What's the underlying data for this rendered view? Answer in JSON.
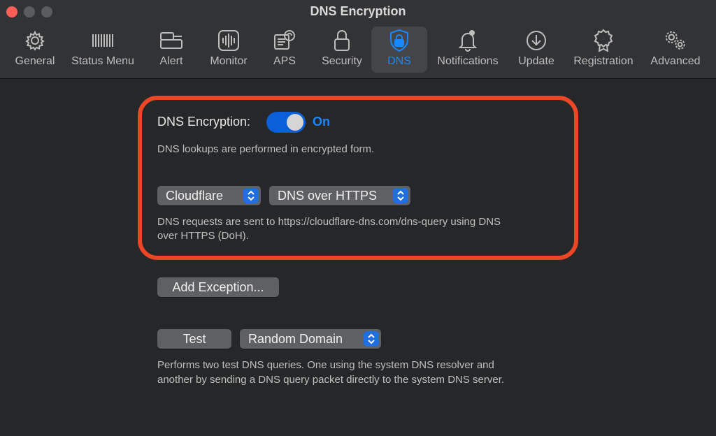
{
  "window": {
    "title": "DNS Encryption"
  },
  "toolbar": {
    "items": [
      {
        "label": "General",
        "icon": "gear-icon"
      },
      {
        "label": "Status Menu",
        "icon": "status-menu-icon"
      },
      {
        "label": "Alert",
        "icon": "alert-window-icon"
      },
      {
        "label": "Monitor",
        "icon": "monitor-waveform-icon"
      },
      {
        "label": "APS",
        "icon": "aps-document-icon"
      },
      {
        "label": "Security",
        "icon": "lock-icon"
      },
      {
        "label": "DNS",
        "icon": "shield-lock-icon",
        "selected": true
      },
      {
        "label": "Notifications",
        "icon": "bell-icon"
      },
      {
        "label": "Update",
        "icon": "download-circle-icon"
      },
      {
        "label": "Registration",
        "icon": "badge-icon"
      },
      {
        "label": "Advanced",
        "icon": "gears-icon"
      }
    ]
  },
  "dns": {
    "encryption_label": "DNS Encryption:",
    "toggle_on": true,
    "toggle_state_text": "On",
    "encryption_desc": "DNS lookups are performed in encrypted form.",
    "provider": "Cloudflare",
    "protocol": "DNS over HTTPS",
    "request_desc_line1": "DNS requests are sent to https://cloudflare-dns.com/dns-query using DNS",
    "request_desc_line2": "over HTTPS (DoH).",
    "add_exception_label": "Add Exception...",
    "test_label": "Test",
    "test_domain": "Random Domain",
    "test_desc_line1": "Performs two test DNS queries. One using the system DNS resolver and",
    "test_desc_line2": "another by sending a DNS query packet directly to the system DNS server."
  },
  "colors": {
    "accent": "#1a86ff",
    "highlight_border": "#ec4626",
    "background": "#262728",
    "toolbar": "#323335"
  }
}
